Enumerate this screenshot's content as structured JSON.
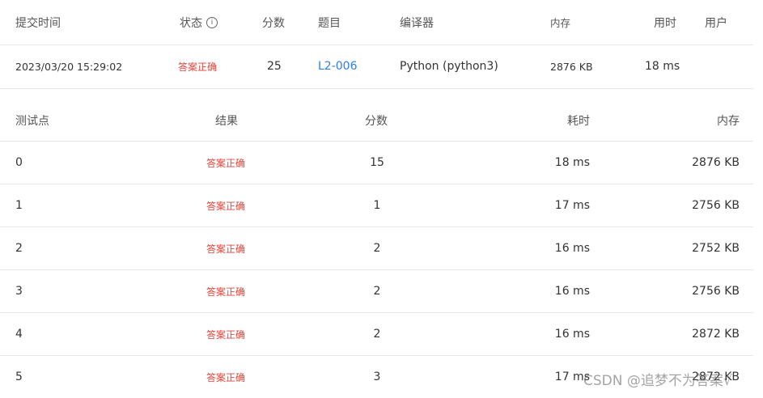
{
  "submission": {
    "headers": {
      "time": "提交时间",
      "status": "状态",
      "score": "分数",
      "problem": "题目",
      "compiler": "编译器",
      "memory": "内存",
      "duration": "用时",
      "user": "用户"
    },
    "row": {
      "time": "2023/03/20 15:29:02",
      "status": "答案正确",
      "score": "25",
      "problem": "L2-006",
      "compiler": "Python (python3)",
      "memory": "2876 KB",
      "duration": "18 ms",
      "user": ""
    }
  },
  "testcases": {
    "headers": {
      "id": "测试点",
      "result": "结果",
      "score": "分数",
      "duration": "耗时",
      "memory": "内存"
    },
    "rows": [
      {
        "id": "0",
        "result": "答案正确",
        "score": "15",
        "duration": "18 ms",
        "memory": "2876 KB"
      },
      {
        "id": "1",
        "result": "答案正确",
        "score": "1",
        "duration": "17 ms",
        "memory": "2756 KB"
      },
      {
        "id": "2",
        "result": "答案正确",
        "score": "2",
        "duration": "16 ms",
        "memory": "2752 KB"
      },
      {
        "id": "3",
        "result": "答案正确",
        "score": "2",
        "duration": "16 ms",
        "memory": "2756 KB"
      },
      {
        "id": "4",
        "result": "答案正确",
        "score": "2",
        "duration": "16 ms",
        "memory": "2872 KB"
      },
      {
        "id": "5",
        "result": "答案正确",
        "score": "3",
        "duration": "17 ms",
        "memory": "2872 KB"
      }
    ]
  },
  "watermark": "CSDN @追梦不为答案√",
  "colors": {
    "accepted": "#e0453a",
    "link": "#2d7fe0"
  }
}
